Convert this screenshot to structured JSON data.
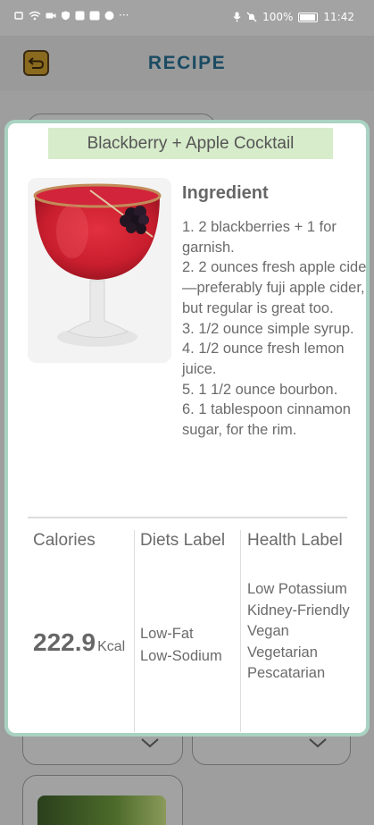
{
  "status_bar": {
    "battery": "100%",
    "time": "11:42",
    "more": "···"
  },
  "header": {
    "title": "RECIPE",
    "back_icon": "back-arrow-icon"
  },
  "dialog": {
    "recipe_title": "Blackberry + Apple Cocktail",
    "image_alt": "cocktail-photo",
    "ingredient_heading": "Ingredient",
    "ingredients": [
      "1. 2 blackberries + 1 for garnish.",
      "2. 2 ounces fresh apple cider—preferably fuji apple cider, but regular is great too.",
      "3. 1/2 ounce simple syrup.",
      "4. 1/2 ounce fresh lemon juice.",
      "5. 1 1/2 ounce bourbon.",
      "6. 1 tablespoon cinnamon sugar, for the rim."
    ],
    "nutrition": {
      "calories_label": "Calories",
      "calories_value": "222.9",
      "calories_unit": "Kcal",
      "diets_label": "Diets Label",
      "diets": [
        "Low-Fat",
        "Low-Sodium"
      ],
      "health_label": "Health Label",
      "health": [
        "Low Potassium",
        "Kidney-Friendly",
        "Vegan",
        "Vegetarian",
        "Pescatarian"
      ]
    }
  },
  "colors": {
    "dialog_border": "#a9d2c2",
    "title_bg": "#d7eccb",
    "header_title": "#1a4b63",
    "overlay": "#9e9e9e"
  }
}
